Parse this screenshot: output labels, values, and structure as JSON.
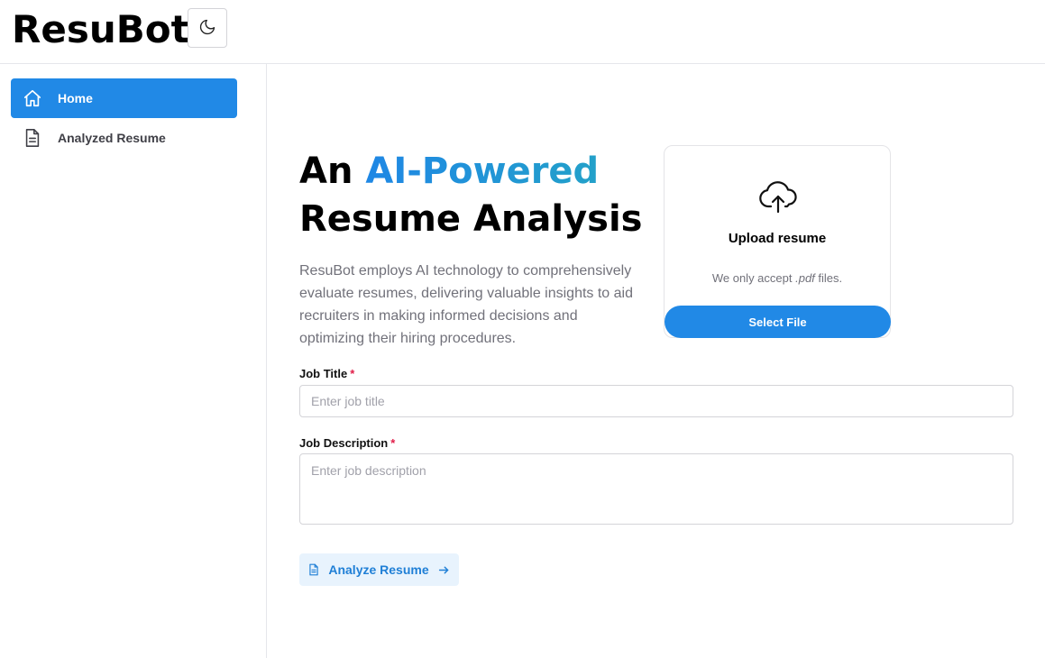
{
  "app": {
    "title": "ResuBot"
  },
  "header": {
    "theme_toggle_icon": "moon-icon"
  },
  "sidebar": {
    "items": [
      {
        "label": "Home",
        "icon": "home-icon",
        "active": true
      },
      {
        "label": "Analyzed Resume",
        "icon": "document-icon",
        "active": false
      }
    ]
  },
  "hero": {
    "title_prefix": "An",
    "title_accent": "AI-Powered",
    "title_line2": "Resume Analysis",
    "description": "ResuBot employs AI technology to comprehensively evaluate resumes, delivering valuable insights to aid recruiters in making informed decisions and optimizing their hiring procedures."
  },
  "upload": {
    "icon": "cloud-upload-icon",
    "title": "Upload resume",
    "note_prefix": "We only accept",
    "note_ext": ".pdf",
    "note_suffix": "files.",
    "button_label": "Select File"
  },
  "form": {
    "job_title": {
      "label": "Job Title",
      "required_mark": "*",
      "placeholder": "Enter job title",
      "value": ""
    },
    "job_description": {
      "label": "Job Description",
      "required_mark": "*",
      "placeholder": "Enter job description",
      "value": ""
    },
    "submit_label": "Analyze Resume"
  },
  "colors": {
    "accent": "#2189e6",
    "accent_gradient_end": "#23a1c9",
    "required": "#e11d48"
  }
}
